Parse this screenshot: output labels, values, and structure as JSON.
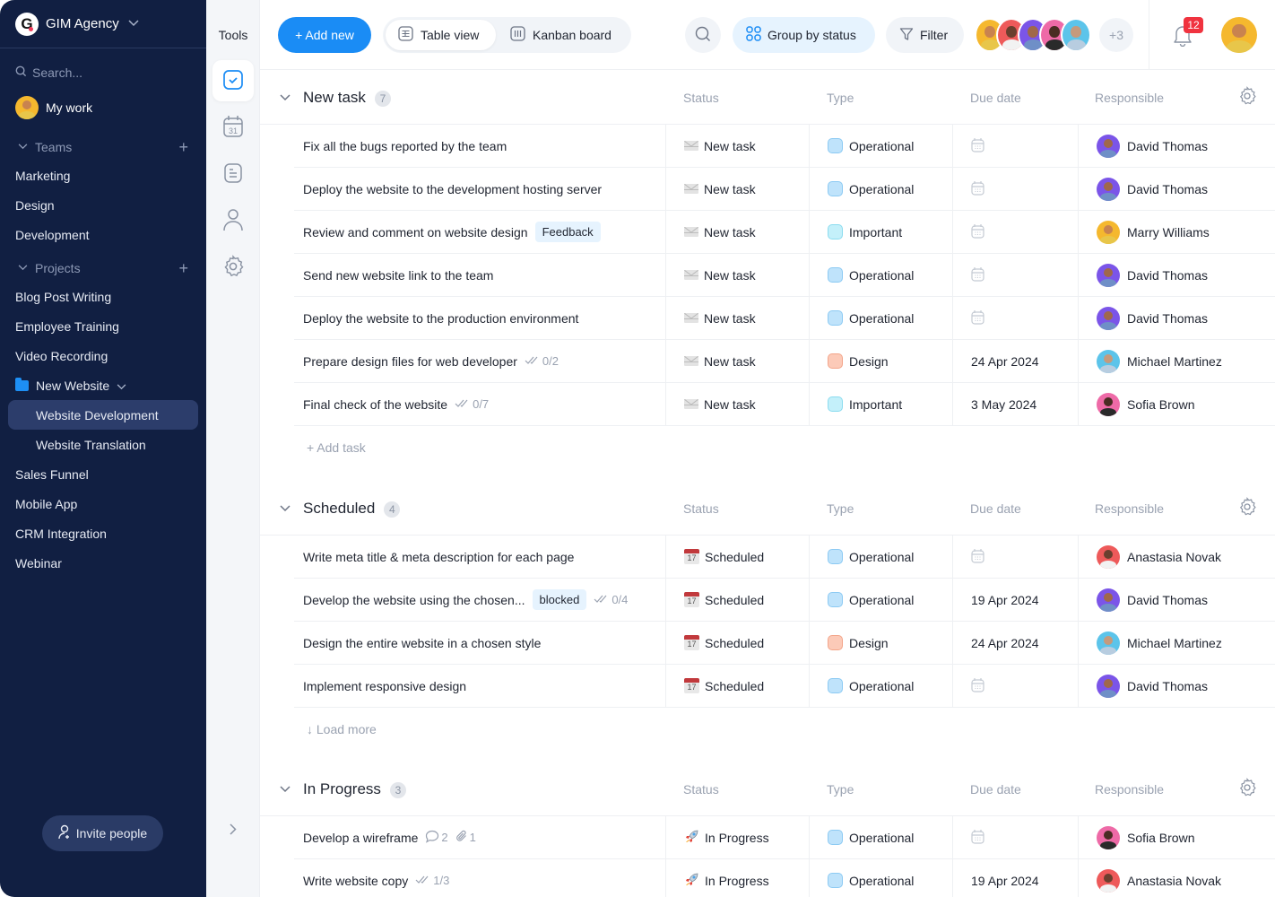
{
  "workspace": {
    "name": "GIM Agency",
    "logo_letter": "G"
  },
  "sidebar": {
    "search_placeholder": "Search...",
    "my_work": "My work",
    "teams_label": "Teams",
    "teams": [
      "Marketing",
      "Design",
      "Development"
    ],
    "projects_label": "Projects",
    "projects_before": [
      "Blog Post Writing",
      "Employee Training",
      "Video Recording"
    ],
    "folder": {
      "label": "New Website",
      "children": [
        "Website Development",
        "Website Translation"
      ],
      "active_child": "Website Development"
    },
    "projects_after": [
      "Sales Funnel",
      "Mobile App",
      "CRM Integration",
      "Webinar"
    ],
    "invite_label": "Invite people"
  },
  "tools": {
    "title": "Tools",
    "items": [
      {
        "icon": "task-check-icon",
        "active": true
      },
      {
        "icon": "calendar-icon",
        "label": "31"
      },
      {
        "icon": "document-icon"
      },
      {
        "icon": "user-icon"
      },
      {
        "icon": "gear-icon"
      }
    ]
  },
  "toolbar": {
    "add_new": "+ Add new",
    "views": [
      {
        "label": "Table view",
        "icon": "table-icon",
        "active": true
      },
      {
        "label": "Kanban board",
        "icon": "kanban-icon",
        "active": false
      }
    ],
    "group_by": "Group by status",
    "filter": "Filter",
    "extra_members": "+3",
    "notifications_count": "12"
  },
  "colors": {
    "sidebar_bg": "#111f42",
    "accent": "#1a8cf5",
    "badge": "#f0333f",
    "type_operational": "#bfe3fb",
    "type_important": "#c4f0fa",
    "type_design": "#fccab8"
  },
  "columns": {
    "status": "Status",
    "type": "Type",
    "due": "Due date",
    "responsible": "Responsible"
  },
  "groups": [
    {
      "title": "New task",
      "count": "7",
      "footer": "+ Add task",
      "rows": [
        {
          "name": "Fix all the bugs reported by the team",
          "status": "New task",
          "type": "Operational",
          "due": "",
          "responsible": "David Thomas"
        },
        {
          "name": "Deploy the website to the development hosting server",
          "status": "New task",
          "type": "Operational",
          "due": "",
          "responsible": "David Thomas"
        },
        {
          "name": "Review and comment on website design",
          "tag": "Feedback",
          "status": "New task",
          "type": "Important",
          "due": "",
          "responsible": "Marry Williams"
        },
        {
          "name": "Send new website link to the team",
          "status": "New task",
          "type": "Operational",
          "due": "",
          "responsible": "David Thomas"
        },
        {
          "name": "Deploy the website to the production environment",
          "status": "New task",
          "type": "Operational",
          "due": "",
          "responsible": "David Thomas"
        },
        {
          "name": "Prepare design files for web developer",
          "checklist": "0/2",
          "status": "New task",
          "type": "Design",
          "due": "24 Apr 2024",
          "responsible": "Michael Martinez"
        },
        {
          "name": "Final check of the website",
          "checklist": "0/7",
          "status": "New task",
          "type": "Important",
          "due": "3 May 2024",
          "responsible": "Sofia Brown"
        }
      ]
    },
    {
      "title": "Scheduled",
      "count": "4",
      "footer": "↓ Load more",
      "rows": [
        {
          "name": "Write meta title & meta description for each page",
          "status": "Scheduled",
          "type": "Operational",
          "due": "",
          "responsible": "Anastasia Novak"
        },
        {
          "name": "Develop the website using the chosen...",
          "tag": "blocked",
          "checklist": "0/4",
          "status": "Scheduled",
          "type": "Operational",
          "due": "19 Apr 2024",
          "responsible": "David Thomas"
        },
        {
          "name": "Design the entire website in a chosen style",
          "status": "Scheduled",
          "type": "Design",
          "due": "24 Apr 2024",
          "responsible": "Michael Martinez"
        },
        {
          "name": "Implement responsive design",
          "status": "Scheduled",
          "type": "Operational",
          "due": "",
          "responsible": "David Thomas"
        }
      ]
    },
    {
      "title": "In Progress",
      "count": "3",
      "rows": [
        {
          "name": "Develop a wireframe",
          "comments": "2",
          "attachments": "1",
          "status": "In Progress",
          "type": "Operational",
          "due": "",
          "responsible": "Sofia Brown"
        },
        {
          "name": "Write website copy",
          "checklist": "1/3",
          "status": "In Progress",
          "type": "Operational",
          "due": "19 Apr 2024",
          "responsible": "Anastasia Novak"
        }
      ]
    }
  ]
}
